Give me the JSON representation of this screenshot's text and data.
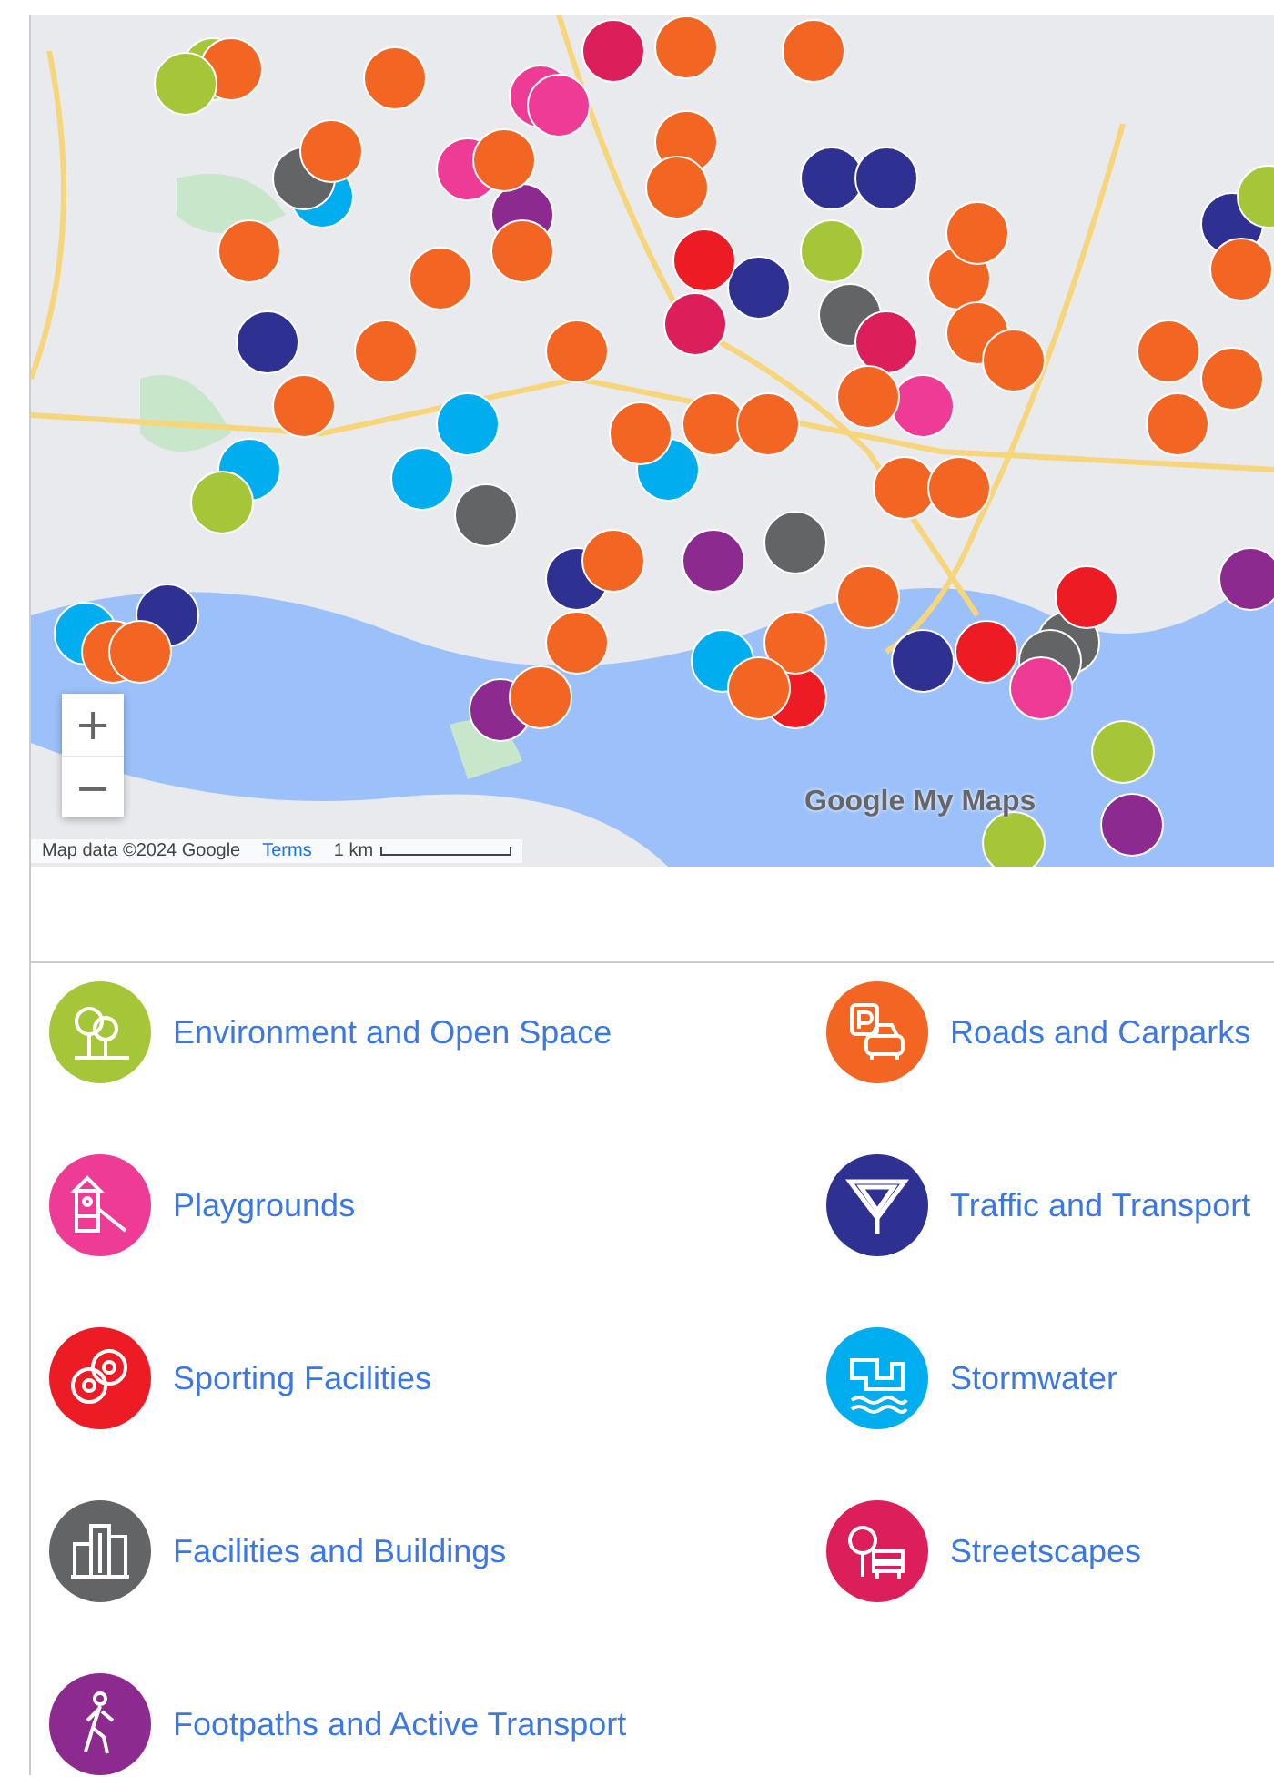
{
  "map": {
    "zoom_in": "+",
    "zoom_out": "−",
    "attribution": "Map data ©2024 Google",
    "terms": "Terms",
    "scale": "1 km",
    "logo": "Google My Maps"
  },
  "legend": [
    {
      "kind": "environment",
      "label": "Environment and Open Space",
      "color": "#a5c639"
    },
    {
      "kind": "roads",
      "label": "Roads and Carparks",
      "color": "#f26522"
    },
    {
      "kind": "playground",
      "label": "Playgrounds",
      "color": "#ee3b96"
    },
    {
      "kind": "traffic",
      "label": "Traffic and Transport",
      "color": "#2e3192"
    },
    {
      "kind": "sport",
      "label": "Sporting Facilities",
      "color": "#ed1c24"
    },
    {
      "kind": "stormwater",
      "label": "Stormwater",
      "color": "#00aeef"
    },
    {
      "kind": "buildings",
      "label": "Facilities and Buildings",
      "color": "#636466"
    },
    {
      "kind": "streetscape",
      "label": "Streetscapes",
      "color": "#dc1e5a"
    },
    {
      "kind": "footpath",
      "label": "Footpaths and Active Transport",
      "color": "#8d2a90"
    }
  ]
}
